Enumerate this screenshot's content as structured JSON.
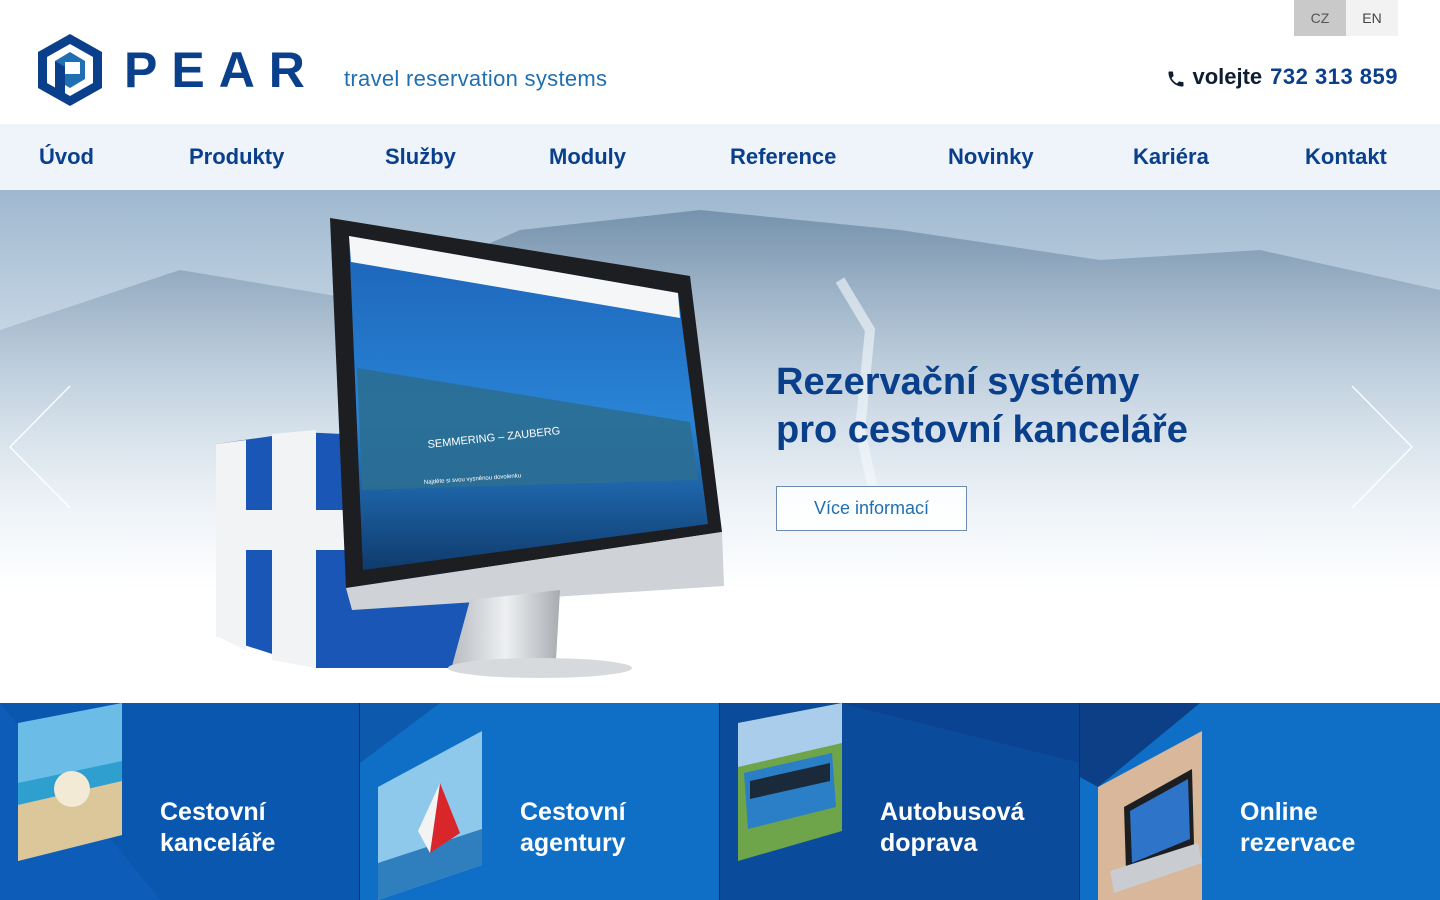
{
  "brand": {
    "name": "PEAR",
    "tagline": "travel reservation systems"
  },
  "languages": [
    {
      "label": "CZ",
      "active": true
    },
    {
      "label": "EN",
      "active": false
    }
  ],
  "contact": {
    "prefix": "volejte",
    "number": "732 313 859",
    "icon": "phone-icon"
  },
  "nav": [
    {
      "label": "Úvod"
    },
    {
      "label": "Produkty"
    },
    {
      "label": "Služby"
    },
    {
      "label": "Moduly"
    },
    {
      "label": "Reference"
    },
    {
      "label": "Novinky"
    },
    {
      "label": "Kariéra"
    },
    {
      "label": "Kontakt"
    }
  ],
  "hero": {
    "title_line1": "Rezervační systémy",
    "title_line2": "pro cestovní kanceláře",
    "button": "Více informací",
    "screen_caption": "SEMMERING – ZAUBERG",
    "screen_search_title": "Najděte si svou vysněnou dovolenku"
  },
  "tiles": [
    {
      "line1": "Cestovní",
      "line2": "kanceláře",
      "icon": "beach-image"
    },
    {
      "line1": "Cestovní",
      "line2": "agentury",
      "icon": "sailboat-image"
    },
    {
      "line1": "Autobusová",
      "line2": "doprava",
      "icon": "bus-image"
    },
    {
      "line1": "Online",
      "line2": "rezervace",
      "icon": "laptop-image"
    }
  ],
  "colors": {
    "brand_blue": "#0a3f8c",
    "accent_blue": "#1f6fb2",
    "tile_blue": "#0b4fa8",
    "nav_bg": "#eef4fa"
  }
}
